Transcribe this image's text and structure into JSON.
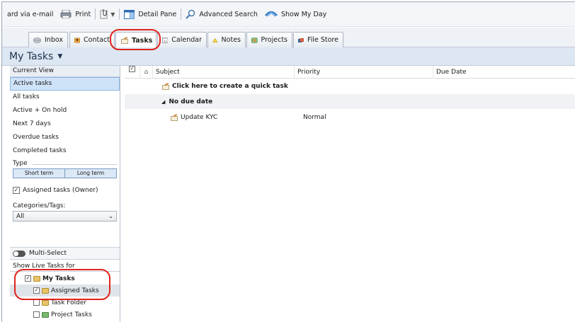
{
  "toolbar": {
    "forward_label": "ard via e-mail",
    "print_label": "Print",
    "detail_pane_label": "Detail Pane",
    "advanced_search_label": "Advanced Search",
    "show_my_day_label": "Show My Day"
  },
  "tabs": [
    {
      "label": "Inbox"
    },
    {
      "label": "Contact"
    },
    {
      "label": "Tasks"
    },
    {
      "label": "Calendar"
    },
    {
      "label": "Notes"
    },
    {
      "label": "Projects"
    },
    {
      "label": "File Store"
    }
  ],
  "view_header": {
    "title": "My Tasks"
  },
  "left_panel": {
    "current_view_header": "Current View",
    "views": [
      {
        "label": "Active tasks"
      },
      {
        "label": "All tasks"
      },
      {
        "label": "Active + On hold"
      },
      {
        "label": "Next 7 days"
      },
      {
        "label": "Overdue tasks"
      },
      {
        "label": "Completed tasks"
      }
    ],
    "type_label": "Type",
    "type_options": [
      "Short term",
      "Long term"
    ],
    "assigned_owner_label": "Assigned tasks (Owner)",
    "categories_label": "Categories/Tags:",
    "categories_value": "All",
    "multi_select_label": "Multi-Select",
    "live_tasks_header": "Show Live Tasks for",
    "tree": [
      {
        "label": "My Tasks"
      },
      {
        "label": "Assigned Tasks"
      },
      {
        "label": "Task Folder"
      },
      {
        "label": "Project Tasks"
      }
    ]
  },
  "grid": {
    "columns": {
      "subject": "Subject",
      "priority": "Priority",
      "due_date": "Due Date"
    },
    "quick_task_label": "Click here to create a quick task",
    "group_label": "No due date",
    "tasks": [
      {
        "subject": "Update KYC",
        "priority": "Normal",
        "due_date": ""
      }
    ]
  },
  "colors": {
    "annotation": "#e0221a",
    "view_header_bg": "#dde7f3",
    "selected_view_bg": "#cfe3f8"
  }
}
